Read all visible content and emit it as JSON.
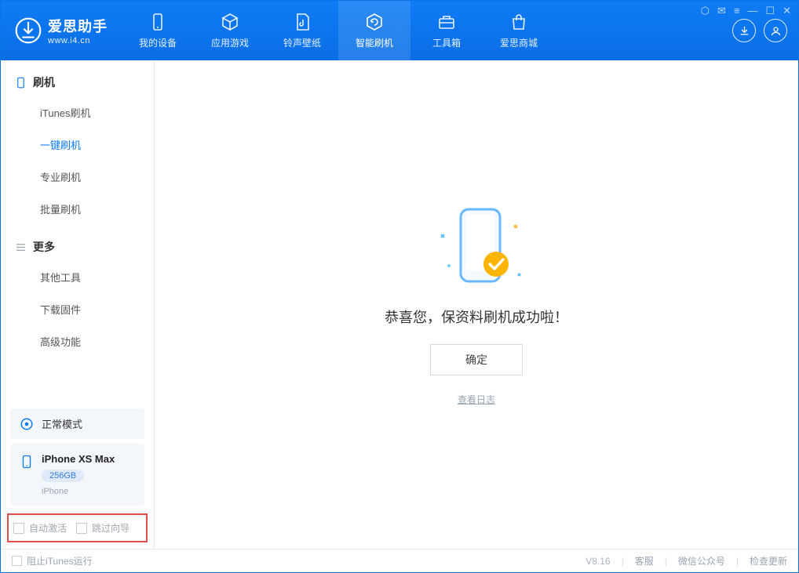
{
  "app": {
    "name": "爱思助手",
    "website": "www.i4.cn"
  },
  "nav": {
    "tabs": [
      {
        "label": "我的设备"
      },
      {
        "label": "应用游戏"
      },
      {
        "label": "铃声壁纸"
      },
      {
        "label": "智能刷机"
      },
      {
        "label": "工具箱"
      },
      {
        "label": "爱思商城"
      }
    ],
    "active_index": 3
  },
  "sidebar": {
    "groups": [
      {
        "title": "刷机",
        "items": [
          {
            "label": "iTunes刷机"
          },
          {
            "label": "一键刷机"
          },
          {
            "label": "专业刷机"
          },
          {
            "label": "批量刷机"
          }
        ],
        "active_index": 1
      },
      {
        "title": "更多",
        "items": [
          {
            "label": "其他工具"
          },
          {
            "label": "下载固件"
          },
          {
            "label": "高级功能"
          }
        ]
      }
    ],
    "mode_label": "正常模式",
    "device": {
      "name": "iPhone XS Max",
      "capacity": "256GB",
      "type": "iPhone"
    },
    "options": {
      "auto_activate": "自动激活",
      "skip_guide": "跳过向导"
    }
  },
  "main": {
    "success_message": "恭喜您，保资料刷机成功啦！",
    "ok_button": "确定",
    "view_log": "查看日志"
  },
  "footer": {
    "block_itunes": "阻止iTunes运行",
    "version": "V8.16",
    "customer_service": "客服",
    "wechat_public": "微信公众号",
    "check_update": "检查更新"
  }
}
